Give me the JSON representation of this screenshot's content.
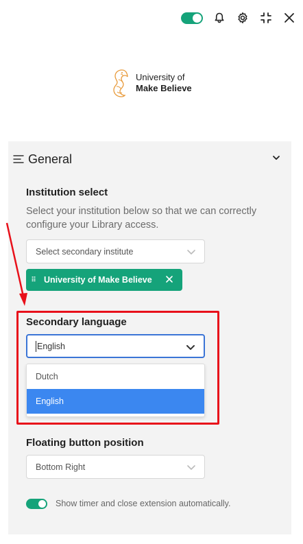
{
  "toolbar": {
    "auto_close_enabled": true,
    "icons": [
      "toggle-icon",
      "bell-icon",
      "gear-icon",
      "minimize-icon",
      "close-icon"
    ]
  },
  "logo": {
    "line1": "University of",
    "line2": "Make Believe"
  },
  "panel": {
    "title": "General",
    "institution": {
      "label": "Institution select",
      "help": "Select your institution below so that we can correctly configure your Library access.",
      "placeholder": "Select secondary institute",
      "selected_chip": "University of Make Believe"
    },
    "secondary_language": {
      "label": "Secondary language",
      "value": "English",
      "options": [
        {
          "label": "Dutch",
          "selected": false
        },
        {
          "label": "English",
          "selected": true
        }
      ]
    },
    "floating_button": {
      "label": "Floating button position",
      "value": "Bottom Right"
    },
    "auto_close": {
      "enabled": true,
      "label": "Show timer and close extension automatically."
    }
  },
  "colors": {
    "accent_green": "#15a37a",
    "focus_blue": "#3a74d6",
    "selected_blue": "#3b87f0",
    "annotation_red": "#e8101a"
  }
}
